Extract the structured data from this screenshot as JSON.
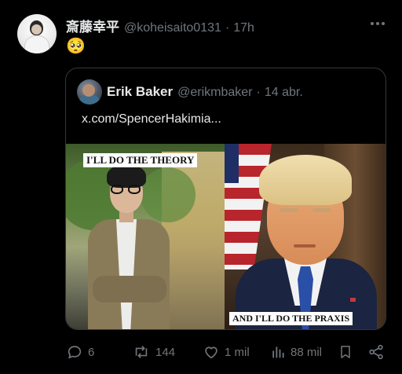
{
  "post": {
    "author_name": "斎藤幸平",
    "author_handle": "@koheisaito0131",
    "separator": "·",
    "time": "17h",
    "text": "🥺"
  },
  "quote": {
    "author_name": "Erik Baker",
    "author_handle": "@erikmbaker",
    "separator": "·",
    "time": "14 abr.",
    "link_text": "x.com/SpencerHakimia...",
    "media": {
      "left_caption": "I'LL DO THE THEORY",
      "right_caption": "AND I'LL DO THE PRAXIS"
    }
  },
  "actions": {
    "replies": "6",
    "reposts": "144",
    "likes": "1 mil",
    "views": "88 mil"
  },
  "icons": [
    "more-icon",
    "reply-icon",
    "repost-icon",
    "like-icon",
    "views-icon",
    "bookmark-icon",
    "share-icon"
  ],
  "colors": {
    "background": "#000000",
    "text": "#e7e9ea",
    "muted": "#71767b",
    "border": "#333639"
  }
}
